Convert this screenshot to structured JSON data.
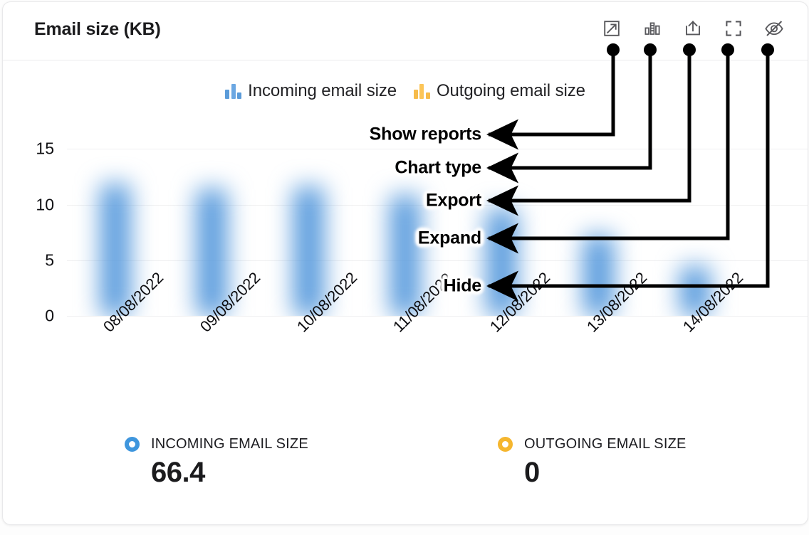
{
  "card": {
    "title": "Email size (KB)"
  },
  "toolbar": {
    "buttons": [
      {
        "name": "show-reports",
        "icon": "external-link-icon",
        "callout": "Show reports"
      },
      {
        "name": "chart-type",
        "icon": "bar-chart-icon",
        "callout": "Chart type"
      },
      {
        "name": "export",
        "icon": "upload-share-icon",
        "callout": "Export"
      },
      {
        "name": "expand",
        "icon": "expand-icon",
        "callout": "Expand"
      },
      {
        "name": "hide",
        "icon": "eye-slash-icon",
        "callout": "Hide"
      }
    ]
  },
  "legend": {
    "items": [
      {
        "label": "Incoming email size",
        "color": "#4f95db"
      },
      {
        "label": "Outgoing email size",
        "color": "#f9b93f"
      }
    ]
  },
  "stats": [
    {
      "label": "INCOMING EMAIL SIZE",
      "value": "66.4",
      "color": "#3f96dd"
    },
    {
      "label": "OUTGOING EMAIL SIZE",
      "value": "0",
      "color": "#f5b62e"
    }
  ],
  "colors": {
    "incoming": "#4f95db",
    "outgoing": "#f9b93f",
    "annotation": "#000000",
    "card_border": "#e8e8ea",
    "gridline": "#f0f0f1"
  },
  "chart_data": {
    "type": "bar",
    "title": "Email size (KB)",
    "xlabel": "",
    "ylabel": "",
    "grid": true,
    "blurred": true,
    "legend_position": "top",
    "categories": [
      "08/08/2022",
      "09/08/2022",
      "10/08/2022",
      "11/08/2022",
      "12/08/2022",
      "13/08/2022",
      "14/08/2022"
    ],
    "yticks": [
      0,
      5,
      10,
      15
    ],
    "ylim": [
      0,
      17
    ],
    "series": [
      {
        "name": "Incoming email size",
        "color": "#4f95db",
        "values": [
          11.8,
          11.4,
          11.6,
          10.8,
          9.6,
          7.2,
          4.4
        ]
      },
      {
        "name": "Outgoing email size",
        "color": "#f9b93f",
        "values": [
          0,
          0,
          0,
          0,
          0,
          0,
          0
        ]
      }
    ],
    "totals": {
      "Incoming email size": 66.4,
      "Outgoing email size": 0
    }
  }
}
